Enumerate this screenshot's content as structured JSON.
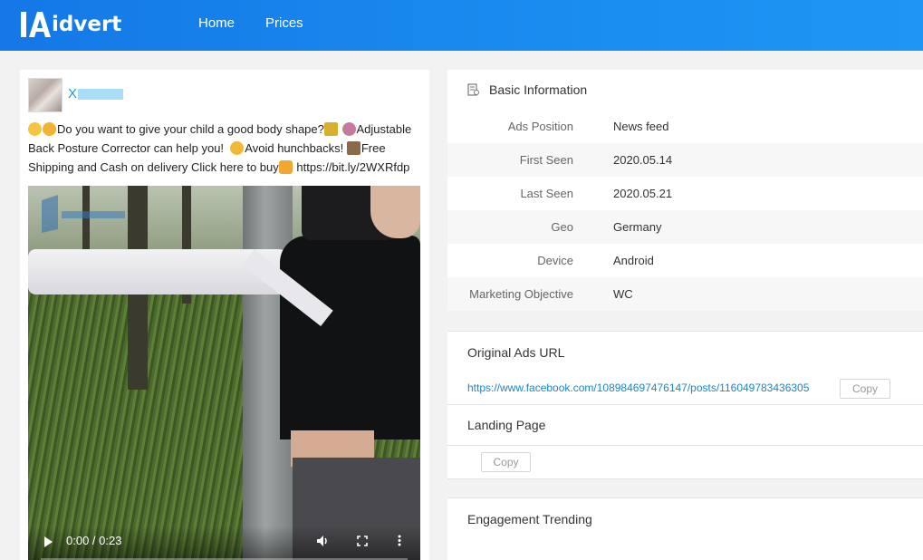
{
  "header": {
    "logo_text": "idvert",
    "nav": [
      {
        "label": "Home"
      },
      {
        "label": "Prices"
      }
    ],
    "brand_color": "#1a8cf0"
  },
  "ad": {
    "author": "X",
    "text_parts": [
      "Do you want to give your child a good body shape?",
      "Adjustable Back Posture Corrector can help you!",
      "Avoid hunchbacks!",
      "Free Shipping and Cash on delivery Click here to buy",
      "https://bit.ly/2WXRfdp"
    ],
    "video": {
      "time": "0:00 / 0:23",
      "progress": 0
    }
  },
  "basic_info": {
    "title": "Basic Information",
    "rows": [
      {
        "label": "Ads Position",
        "value": "News feed"
      },
      {
        "label": "First Seen",
        "value": "2020.05.14"
      },
      {
        "label": "Last Seen",
        "value": "2020.05.21"
      },
      {
        "label": "Geo",
        "value": "Germany"
      },
      {
        "label": "Device",
        "value": "Android"
      },
      {
        "label": "Marketing Objective",
        "value": "WC"
      }
    ]
  },
  "original_url": {
    "title": "Original Ads URL",
    "url": "https://www.facebook.com/108984697476147/posts/116049783436305",
    "copy_label": "Copy"
  },
  "landing_page": {
    "title": "Landing Page",
    "copy_label": "Copy"
  },
  "engagement": {
    "title": "Engagement Trending"
  }
}
